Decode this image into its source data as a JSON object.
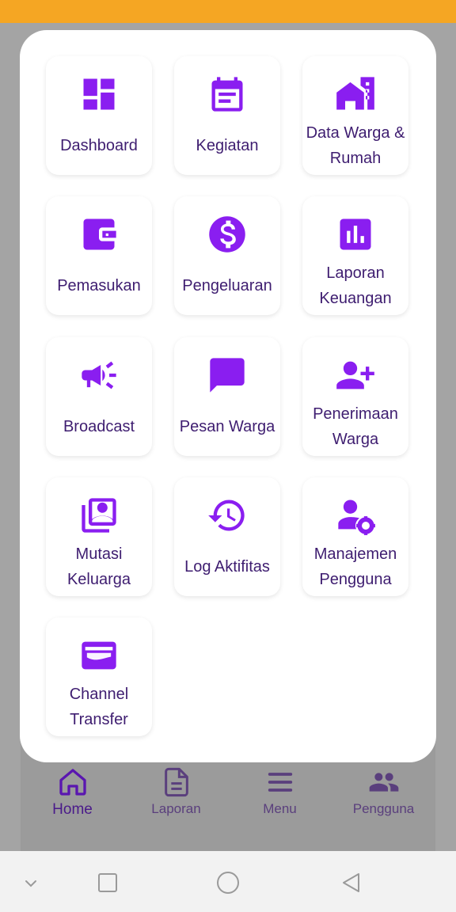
{
  "colors": {
    "accent": "#8a1ef0",
    "label": "#3e1d70",
    "status_bar": "#f5a623",
    "nav_icon_dim": "#6a3f9a",
    "nav_icon_active": "#7b22d6"
  },
  "menu": {
    "items": [
      {
        "label": "Dashboard",
        "icon": "dashboard-icon"
      },
      {
        "label": "Kegiatan",
        "icon": "calendar-icon"
      },
      {
        "label": "Data Warga & Rumah",
        "icon": "house-icon"
      },
      {
        "label": "Pemasukan",
        "icon": "wallet-icon"
      },
      {
        "label": "Pengeluaran",
        "icon": "dollar-icon"
      },
      {
        "label": "Laporan Keuangan",
        "icon": "bar-chart-icon"
      },
      {
        "label": "Broadcast",
        "icon": "megaphone-icon"
      },
      {
        "label": "Pesan Warga",
        "icon": "chat-icon"
      },
      {
        "label": "Penerimaan Warga",
        "icon": "person-add-icon"
      },
      {
        "label": "Mutasi Keluarga",
        "icon": "contacts-icon"
      },
      {
        "label": "Log Aktifitas",
        "icon": "history-icon"
      },
      {
        "label": "Manajemen Pengguna",
        "icon": "user-gear-icon"
      },
      {
        "label": "Channel Transfer",
        "icon": "card-icon"
      }
    ]
  },
  "bottom_nav": {
    "items": [
      {
        "label": "Home",
        "icon": "home-icon",
        "active": true
      },
      {
        "label": "Laporan",
        "icon": "document-icon",
        "active": false
      },
      {
        "label": "Menu",
        "icon": "hamburger-icon",
        "active": false
      },
      {
        "label": "Pengguna",
        "icon": "people-icon",
        "active": false
      }
    ]
  },
  "system_nav": {
    "items": [
      "chevron-down-icon",
      "recents-icon",
      "home-circle-icon",
      "back-icon"
    ]
  }
}
